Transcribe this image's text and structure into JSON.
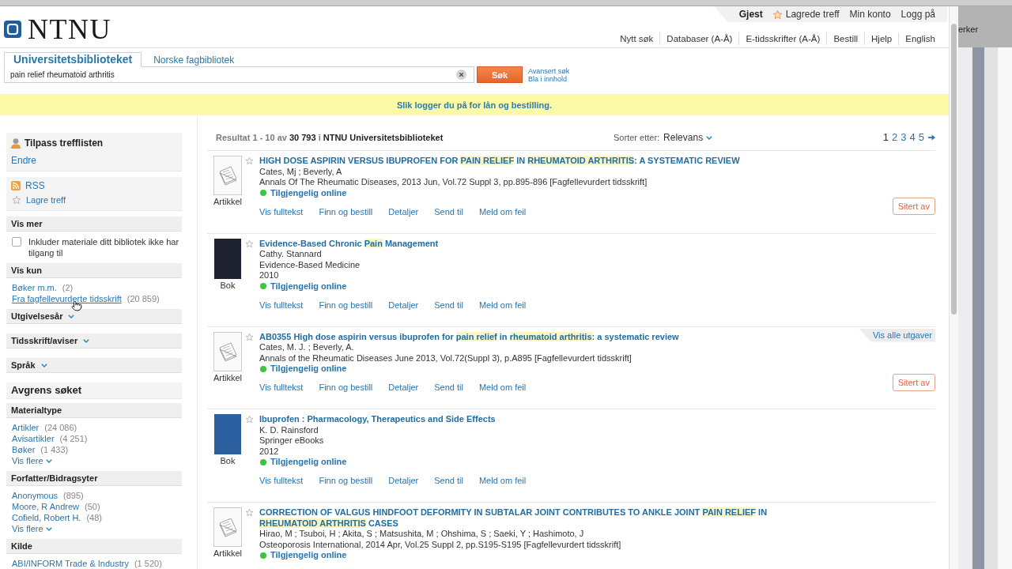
{
  "user_bar": {
    "user": "Gjest",
    "links": [
      {
        "kind": "starred",
        "label": "Lagrede treff"
      },
      {
        "kind": "plain",
        "label": "Min konto"
      },
      {
        "kind": "plain",
        "label": "Logg på"
      }
    ]
  },
  "logo": {
    "text": "NTNU"
  },
  "nav": [
    "Nytt søk",
    "Databaser (A-Å)",
    "E-tidsskrifter (A-Å)",
    "Bestill",
    "Hjelp",
    "English"
  ],
  "search": {
    "tabs": [
      {
        "label": "Universitetsbiblioteket",
        "selected": true
      },
      {
        "label": "Norske fagbibliotek",
        "selected": false
      }
    ],
    "value": "pain relief rheumatoid arthritis",
    "button": "Søk",
    "links": [
      "Avansert søk",
      "Bla i innhold"
    ]
  },
  "banner": {
    "text": "Slik logger du på for lån og bestilling."
  },
  "sidebar": {
    "profile": {
      "title": "Tilpass trefflisten",
      "link": "Endre"
    },
    "tools": [
      {
        "kind": "rss",
        "label": "RSS"
      },
      {
        "kind": "star",
        "label": "Lagre treff"
      }
    ],
    "sections": [
      {
        "kind": "checkbox",
        "title": "Vis mer",
        "options": [
          {
            "label": "Inkluder materiale ditt bibliotek ikke har tilgang til",
            "checked": false
          }
        ]
      },
      {
        "kind": "facet",
        "title": "Vis kun",
        "items": [
          {
            "label": "Bøker m.m.",
            "count": "(2)",
            "hovered": false
          },
          {
            "label": "Fra fagfellevurderte tidsskrift",
            "count": "(20 859)",
            "hovered": true
          }
        ]
      },
      {
        "kind": "collapsible",
        "title": "Utgivelsesår",
        "expanded": false
      },
      {
        "kind": "collapsible",
        "title": "Tidsskrift/aviser",
        "expanded": false
      },
      {
        "kind": "collapsible",
        "title": "Språk",
        "expanded": false
      },
      {
        "kind": "heading",
        "title": "Avgrens søket"
      },
      {
        "kind": "facet",
        "title": "Materialtype",
        "items": [
          {
            "label": "Artikler",
            "count": "(24 086)",
            "hovered": false
          },
          {
            "label": "Avisartikler",
            "count": "(4 251)",
            "hovered": false
          },
          {
            "label": "Bøker",
            "count": "(1 433)",
            "hovered": false
          }
        ],
        "more": "Vis flere"
      },
      {
        "kind": "facet",
        "title": "Forfatter/Bidragsyter",
        "items": [
          {
            "label": "Anonymous",
            "count": "(895)",
            "hovered": false
          },
          {
            "label": "Moore, R Andrew",
            "count": "(50)",
            "hovered": false
          },
          {
            "label": "Cofield, Robert H.",
            "count": "(48)",
            "hovered": false
          }
        ],
        "more": "Vis flere"
      },
      {
        "kind": "facet",
        "title": "Kilde",
        "items": [
          {
            "label": "ABI/INFORM Trade & Industry",
            "count": "(1 520)",
            "hovered": false
          }
        ]
      }
    ]
  },
  "results": {
    "summary": "Resultat 1 - 10 av **30 793** i **NTNU Universitetsbiblioteket**",
    "sort": {
      "label": "Sorter etter:",
      "value": "Relevans"
    },
    "pages": [
      {
        "label": "1",
        "selected": true
      },
      {
        "label": "2",
        "selected": false
      },
      {
        "label": "3",
        "selected": false
      },
      {
        "label": "4",
        "selected": false
      },
      {
        "label": "5",
        "selected": false
      }
    ],
    "items": [
      {
        "type": "Artikkel",
        "thumbnail": {
          "kind": "document"
        },
        "saved": false,
        "title": [
          {
            "text": "HIGH DOSE ASPIRIN VERSUS IBUPROFEN FOR ",
            "highlight": false
          },
          {
            "text": "PAIN RELIEF",
            "highlight": true
          },
          {
            "text": " IN ",
            "highlight": false
          },
          {
            "text": "RHEUMATOID ARTHRITIS",
            "highlight": true
          },
          {
            "text": ": A SYSTEMATIC REVIEW",
            "highlight": false
          }
        ],
        "lines": [
          "Cates, Mj ; Beverly, A",
          "Annals Of The Rheumatic Diseases, 2013 Jun, Vol.72 Suppl 3, pp.895-896 [Fagfellevurdert tidsskrift]"
        ],
        "availability": {
          "label": "Tilgjengelig online",
          "color": "#3fc43f"
        },
        "actions": [
          "Vis fulltekst",
          "Finn og bestill",
          "Detaljer",
          "Send til",
          "Meld om feil"
        ],
        "cited_by": "Sitert av"
      },
      {
        "type": "Bok",
        "thumbnail": {
          "kind": "cover",
          "color": "#1e2230"
        },
        "saved": false,
        "title": [
          {
            "text": "Evidence-Based Chronic ",
            "highlight": false
          },
          {
            "text": "Pain",
            "highlight": true
          },
          {
            "text": " Management",
            "highlight": false
          }
        ],
        "lines": [
          "Cathy. Stannard",
          "Evidence-Based Medicine",
          "2010"
        ],
        "availability": {
          "label": "Tilgjengelig online",
          "color": "#3fc43f"
        },
        "actions": [
          "Vis fulltekst",
          "Finn og bestill",
          "Detaljer",
          "Send til",
          "Meld om feil"
        ]
      },
      {
        "type": "Artikkel",
        "thumbnail": {
          "kind": "document"
        },
        "saved": false,
        "editions": "Vis alle utgaver",
        "title": [
          {
            "text": "AB0355 High dose aspirin versus ibuprofen for ",
            "highlight": false
          },
          {
            "text": "pain relief",
            "highlight": true
          },
          {
            "text": " in ",
            "highlight": false
          },
          {
            "text": "rheumatoid arthritis",
            "highlight": true
          },
          {
            "text": ": a systematic review",
            "highlight": false
          }
        ],
        "lines": [
          "Cates, M. J. ; Beverly, A.",
          "Annals of the Rheumatic Diseases June 2013, Vol.72(Suppl 3), p.A895 [Fagfellevurdert tidsskrift]"
        ],
        "availability": {
          "label": "Tilgjengelig online",
          "color": "#3fc43f"
        },
        "actions": [
          "Vis fulltekst",
          "Finn og bestill",
          "Detaljer",
          "Send til",
          "Meld om feil"
        ],
        "cited_by": "Sitert av"
      },
      {
        "type": "Bok",
        "thumbnail": {
          "kind": "cover",
          "color": "#2b5f9f"
        },
        "saved": false,
        "title": [
          {
            "text": "Ibuprofen : Pharmacology, Therapeutics and Side Effects",
            "highlight": false
          }
        ],
        "lines": [
          "K. D. Rainsford",
          "Springer eBooks",
          "2012"
        ],
        "availability": {
          "label": "Tilgjengelig online",
          "color": "#3fc43f"
        },
        "actions": [
          "Vis fulltekst",
          "Finn og bestill",
          "Detaljer",
          "Send til",
          "Meld om feil"
        ]
      },
      {
        "type": "Artikkel",
        "thumbnail": {
          "kind": "document"
        },
        "saved": false,
        "title": [
          {
            "text": "CORRECTION OF VALGUS HINDFOOT DEFORMITY IN SUBTALAR JOINT CONTRIBUTES TO ANKLE JOINT ",
            "highlight": false
          },
          {
            "text": "PAIN RELIEF",
            "highlight": true
          },
          {
            "text": " IN ",
            "highlight": false
          },
          {
            "text": "RHEUMATOID ARTHRITIS",
            "highlight": true
          },
          {
            "text": " CASES",
            "highlight": false
          }
        ],
        "lines": [
          "Hirao, M ; Tsuboi, H ; Akita, S ; Matsushita, M ; Ohshima, S ; Saeki, Y ; Hashimoto, J",
          "Osteoporosis International, 2014 Apr, Vol.25 Suppl 2, pp.S195-S195 [Fagfellevurdert tidsskrift]"
        ],
        "availability": {
          "label": "Tilgjengelig online",
          "color": "#3fc43f"
        }
      }
    ]
  },
  "background_window": {
    "label": "erker"
  }
}
